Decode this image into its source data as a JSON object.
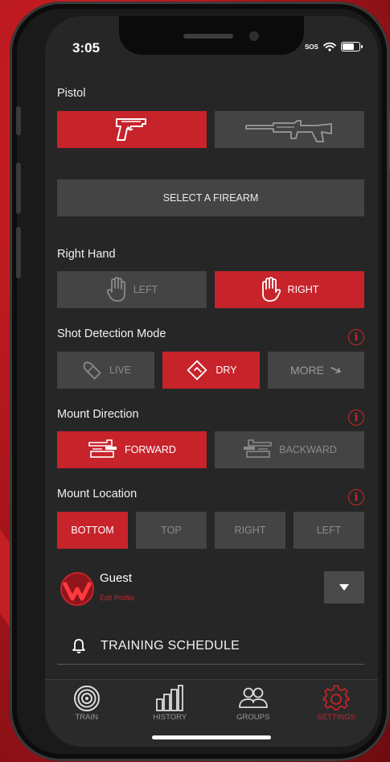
{
  "status_bar": {
    "time": "3:05",
    "sos": "SOS"
  },
  "firearm": {
    "section_label": "Pistol",
    "options": [
      {
        "icon": "pistol-icon",
        "active": true
      },
      {
        "icon": "rifle-icon",
        "active": false
      }
    ],
    "select_label": "SELECT A FIREARM"
  },
  "hand": {
    "section_label": "Right Hand",
    "options": [
      {
        "label": "LEFT",
        "icon": "hand-icon",
        "active": false
      },
      {
        "label": "RIGHT",
        "icon": "hand-icon",
        "active": true
      }
    ]
  },
  "shot_detection": {
    "section_label": "Shot Detection Mode",
    "options": [
      {
        "label": "LIVE",
        "icon": "bullet-icon",
        "active": false
      },
      {
        "label": "DRY",
        "icon": "dry-fire-icon",
        "active": true
      },
      {
        "label": "MORE",
        "icon": "arrow-icon",
        "active": false
      }
    ]
  },
  "mount_direction": {
    "section_label": "Mount Direction",
    "options": [
      {
        "label": "FORWARD",
        "icon": "mount-forward-icon",
        "active": true
      },
      {
        "label": "BACKWARD",
        "icon": "mount-backward-icon",
        "active": false
      }
    ]
  },
  "mount_location": {
    "section_label": "Mount Location",
    "options": [
      {
        "label": "BOTTOM",
        "active": true
      },
      {
        "label": "TOP",
        "active": false
      },
      {
        "label": "RIGHT",
        "active": false
      },
      {
        "label": "LEFT",
        "active": false
      }
    ]
  },
  "profile": {
    "name": "Guest",
    "edit_label": "Edit Profile"
  },
  "menu": {
    "training_schedule": "TRAINING SCHEDULE"
  },
  "tabs": [
    {
      "label": "TRAIN",
      "icon": "target-icon",
      "active": false
    },
    {
      "label": "HISTORY",
      "icon": "bar-chart-icon",
      "active": false
    },
    {
      "label": "GROUPS",
      "icon": "groups-icon",
      "active": false
    },
    {
      "label": "SETTINGS",
      "icon": "gear-icon",
      "active": true
    }
  ],
  "colors": {
    "accent": "#c7232b",
    "button": "#444444",
    "screen_bg": "#262626"
  }
}
